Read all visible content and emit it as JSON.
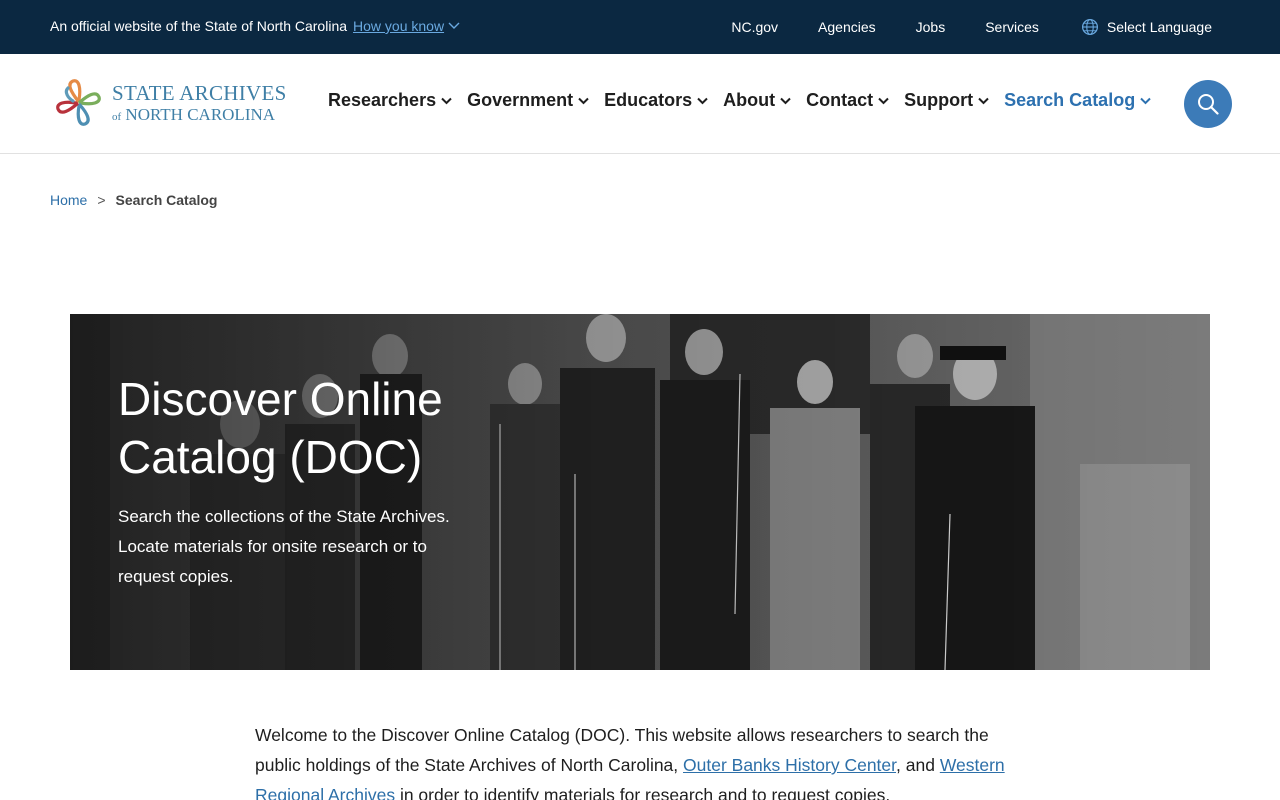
{
  "gov_banner": {
    "official_text": "An official website of the State of North Carolina",
    "how_you_know": "How you know",
    "links": [
      "NC.gov",
      "Agencies",
      "Jobs",
      "Services"
    ],
    "language": "Select Language"
  },
  "logo": {
    "line1": "STATE ARCHIVES",
    "line2_of": "of",
    "line2_rest": "NORTH CAROLINA"
  },
  "nav": {
    "items": [
      "Researchers",
      "Government",
      "Educators",
      "About",
      "Contact",
      "Support",
      "Search Catalog"
    ],
    "active": "Search Catalog",
    "search_icon": "search-icon"
  },
  "breadcrumb": {
    "home": "Home",
    "separator": ">",
    "current": "Search Catalog"
  },
  "hero": {
    "title": "Discover Online Catalog (DOC)",
    "description": "Search the collections of the State Archives. Locate materials for onsite research or to request copies."
  },
  "intro": {
    "text_before": "Welcome to the Discover Online Catalog (DOC). This website allows researchers to search the public holdings of the State Archives of North Carolina, ",
    "link1": "Outer Banks History Center",
    "text_between": ", and ",
    "link2": "Western Regional Archives",
    "text_after": " in order to identify materials for research and to request copies."
  },
  "colors": {
    "gov_bar": "#0b2841",
    "accent_blue": "#2d71b0",
    "search_button": "#3c7bb8",
    "link": "#2d6fa8"
  }
}
